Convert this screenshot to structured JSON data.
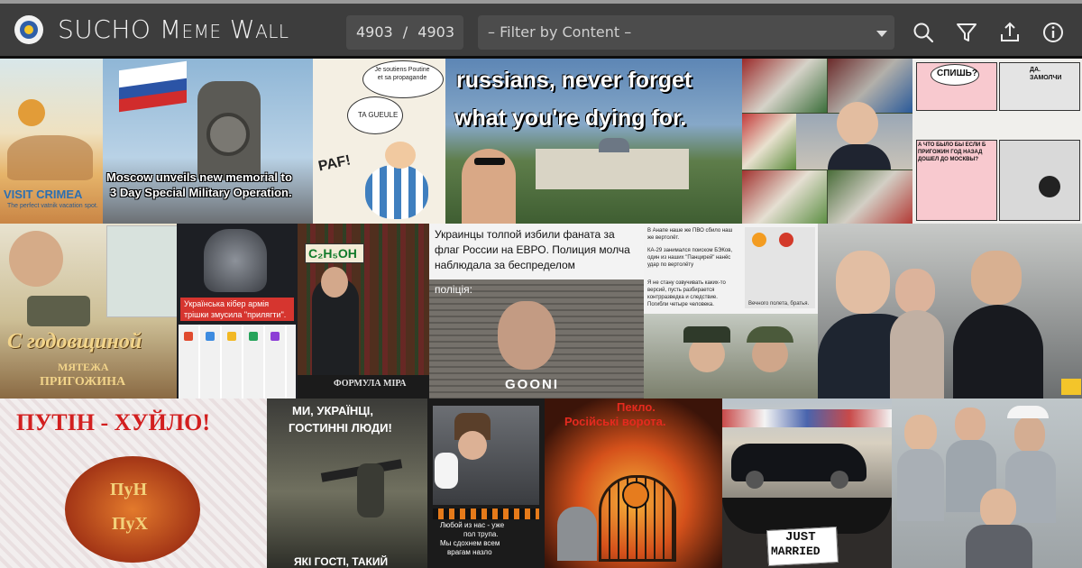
{
  "app": {
    "title": "SUCHO Meme Wall",
    "logo_icon": "sucho-logo-icon"
  },
  "toolbar": {
    "counter_shown": "4903",
    "counter_sep": "/",
    "counter_total": "4903",
    "filter_placeholder": "– Filter by Content –",
    "icons": [
      "search-icon",
      "filter-icon",
      "share-icon",
      "info-icon"
    ]
  },
  "memes": {
    "crimea": {
      "text": "VISIT CRIMEA",
      "sub": "The perfect vatnik vacation spot."
    },
    "memorial": {
      "text1": "Moscow unveils new memorial to",
      "text2": "3 Day Special Military Operation."
    },
    "asterix": {
      "bubble1": "Je soutiens Poutine et sa propagande",
      "bubble2": "TA GUEULE",
      "sound": "PAF!"
    },
    "palace": {
      "line1": "russians, never forget",
      "line2": "what you're dying for."
    },
    "comic": {
      "b1": "СПИШЬ?",
      "b2": "ДА. ЗАМОЛЧИ",
      "b3": "А ЧТО БЫЛО БЫ ЕСЛИ Б ПРИГОЖИН ГОД НАЗАД ДОШЕЛ ДО МОСКВЫ?"
    },
    "anniversary": {
      "line1": "С годовщиной",
      "line2": "МЯТЕЖА",
      "line3": "ПРИГОЖИНА"
    },
    "robocop": {
      "text1": "Українська кібер армія",
      "text2": "трішки змусила \"прилягти\"."
    },
    "liquor": {
      "sign": "С₂Н₅ОН",
      "caption": "ФОРМУЛА МІРА"
    },
    "euro": {
      "text": "Украинцы толпой избили фаната за флаг России на ЕВРО. Полиция молча наблюдала за беспределом",
      "label": "поліція:",
      "brand": "GOONI"
    },
    "news": {
      "p1": "В Анапе наше же ПВО сбило наш же вертолёт.",
      "p2": "КА-29 занимался поиском БЭКов, один из наших \"Панцирей\" нанёс удар по вертолёту",
      "p3": "Я не стану озвучивать каких-то версий, пусть разбирается контрразведка и следствие. Погибли четыре человека.",
      "caption": "Вечного полета, братья."
    },
    "putin_sign": {
      "text": "ПУТІН - ХУЙЛО!",
      "egg1": "ПуН",
      "egg2": "ПуХ"
    },
    "guests": {
      "line1": "МИ, УКРАЇНЦІ,",
      "line2": "ГОСТИННІ ЛЮДИ!",
      "line3": "ЯКІ ГОСТІ, ТАКИЙ"
    },
    "gate": {
      "line1": "Пекло.",
      "line2": "Російські ворота."
    },
    "corpses": {
      "line1": "Любой из нас - уже",
      "line2": "пол трупа.",
      "line3": "Мы сдохнем всем",
      "line4": "врагам назло"
    },
    "married": {
      "line1": "JUST",
      "line2": "MARRIED"
    }
  },
  "colors": {
    "header_bg": "#3d3d3d",
    "input_bg": "#4c4c4c",
    "accent_text": "#f2f2f2"
  }
}
